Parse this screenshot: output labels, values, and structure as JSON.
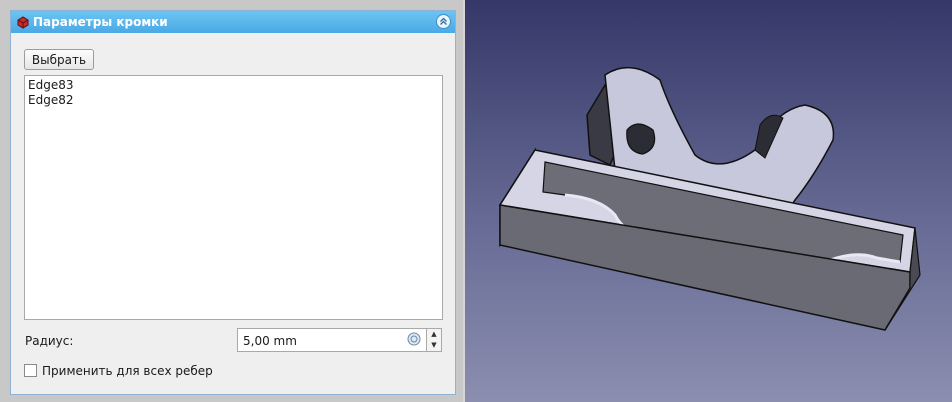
{
  "panel": {
    "title": "Параметры кромки",
    "select_button": "Выбрать",
    "edges": [
      "Edge83",
      "Edge82"
    ],
    "radius_label": "Радиус:",
    "radius_value": "5,00 mm",
    "apply_all_label": "Применить для всех ребер",
    "apply_all_checked": false
  },
  "icons": {
    "app": "freecad-part-icon",
    "collapse": "chevron-double-up-icon",
    "unit": "unit-formula-icon"
  },
  "viewport": {
    "background_top": "#353868",
    "background_bottom": "#8b8eaf",
    "model_face_color": "#6d6d78",
    "model_highlight_color": "#c8c8dc"
  }
}
